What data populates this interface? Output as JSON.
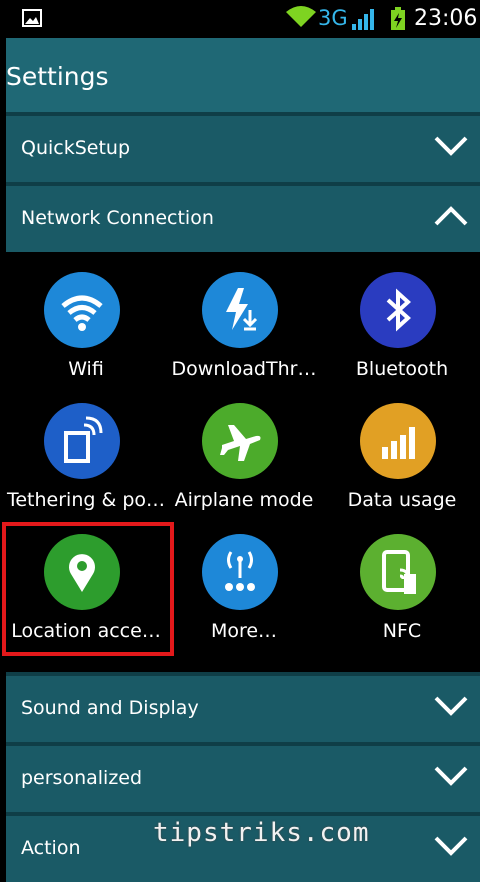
{
  "status_bar": {
    "network_type": "3G",
    "time": "23:06",
    "icons": [
      "image-icon",
      "wifi-icon",
      "signal-icon",
      "battery-icon"
    ]
  },
  "header": {
    "title": "Settings"
  },
  "sections": [
    {
      "label": "QuickSetup",
      "expanded": false
    },
    {
      "label": "Network Connection",
      "expanded": true
    },
    {
      "label": "Sound and Display",
      "expanded": false
    },
    {
      "label": "personalized",
      "expanded": false
    },
    {
      "label": "Action",
      "expanded": false
    }
  ],
  "network_items": [
    {
      "label": "Wifi",
      "icon": "wifi-icon",
      "color": "#1e88d8"
    },
    {
      "label": "DownloadThr…",
      "icon": "download-booster-icon",
      "color": "#1e88d8"
    },
    {
      "label": "Bluetooth",
      "icon": "bluetooth-icon",
      "color": "#2a3cc0"
    },
    {
      "label": "Tethering & po…",
      "icon": "tethering-icon",
      "color": "#1e5fc8"
    },
    {
      "label": "Airplane mode",
      "icon": "airplane-icon",
      "color": "#4cab2b"
    },
    {
      "label": "Data usage",
      "icon": "data-usage-icon",
      "color": "#e1a024"
    },
    {
      "label": "Location acce…",
      "icon": "location-icon",
      "color": "#2d9d2d"
    },
    {
      "label": "More…",
      "icon": "more-networks-icon",
      "color": "#1e88d8"
    },
    {
      "label": "NFC",
      "icon": "nfc-icon",
      "color": "#5cb030"
    }
  ],
  "watermark": "tipstriks.com",
  "colors": {
    "section_bg": "#1a5a66",
    "title_bg": "#1f6875",
    "highlight": "#e3191b"
  }
}
